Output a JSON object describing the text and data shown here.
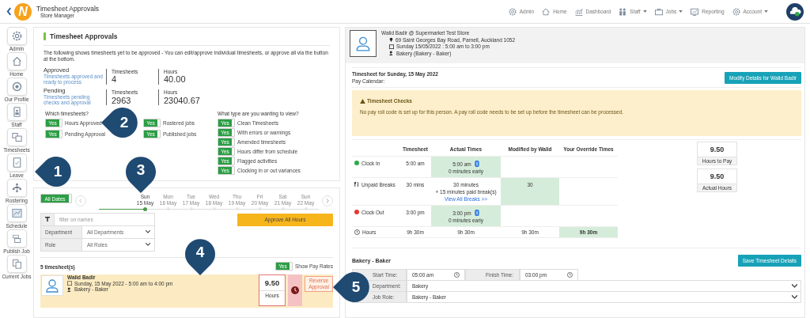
{
  "app": {
    "logo": "N",
    "title": "Timesheet Approvals",
    "subtitle": "Store Manager"
  },
  "nav": [
    {
      "label": "Admin",
      "dropdown": false
    },
    {
      "label": "Home",
      "dropdown": false
    },
    {
      "label": "Dashboard",
      "dropdown": false
    },
    {
      "label": "Staff",
      "dropdown": true
    },
    {
      "label": "Jobs",
      "dropdown": true
    },
    {
      "label": "Reporting",
      "dropdown": false
    },
    {
      "label": "Account",
      "dropdown": true
    }
  ],
  "sidebar": [
    "Admin",
    "Home",
    "Our Profile",
    "Staff",
    "Timesheets",
    "Leave",
    "Rostering",
    "Schedule",
    "Publish Job",
    "Current Jobs"
  ],
  "summary": {
    "title": "Timesheet Approvals",
    "intro": "The following shows timesheets yet to be approved - You can edit/approve individual timesheets, or approve all via the button at the bottom.",
    "stats": [
      {
        "label": "Approved",
        "note": "Timesheets approved and ready to process",
        "timesheets_label": "Timesheets",
        "timesheets": "4",
        "hours_label": "Hours",
        "hours": "40.00"
      },
      {
        "label": "Pending",
        "note": "Timesheets pending checks and approval",
        "timesheets_label": "Timesheets",
        "timesheets": "2963",
        "hours_label": "Hours",
        "hours": "23040.67"
      }
    ]
  },
  "filters": {
    "which_title": "Which timesheets?",
    "which": [
      {
        "label": "Hours Approved",
        "on": true,
        "toggle_text": "Yes"
      },
      {
        "label": "Pending Approval",
        "on": true,
        "toggle_text": "Yes"
      }
    ],
    "jobs": [
      {
        "label": "Rostered jobs",
        "on": true,
        "toggle_text": "Yes"
      },
      {
        "label": "Published jobs",
        "on": true,
        "toggle_text": "Yes"
      }
    ],
    "type_title": "What type are you wanting to view?",
    "types": [
      {
        "label": "Clean Timesheets",
        "on": true,
        "toggle_text": "Yes"
      },
      {
        "label": "With errors or warnings",
        "on": true,
        "toggle_text": "Yes"
      },
      {
        "label": "Amended timesheets",
        "on": true,
        "toggle_text": "Yes"
      },
      {
        "label": "Hours differ from schedule",
        "on": true,
        "toggle_text": "Yes"
      },
      {
        "label": "Flagged activities",
        "on": true,
        "toggle_text": "Yes"
      },
      {
        "label": "Clocking in or out variances",
        "on": true,
        "toggle_text": "Yes"
      }
    ]
  },
  "dates": {
    "all_dates": {
      "label": "All Dates",
      "on": true
    },
    "days": [
      {
        "day": "Sun",
        "date": "15 May",
        "selected": true
      },
      {
        "day": "Mon",
        "date": "16 May",
        "selected": false
      },
      {
        "day": "Tue",
        "date": "17 May",
        "selected": false
      },
      {
        "day": "Wed",
        "date": "18 May",
        "selected": false
      },
      {
        "day": "Thu",
        "date": "19 May",
        "selected": false
      },
      {
        "day": "Fri",
        "date": "20 May",
        "selected": false
      },
      {
        "day": "Sat",
        "date": "21 May",
        "selected": false
      },
      {
        "day": "Sun",
        "date": "22 May",
        "selected": false
      }
    ]
  },
  "search": {
    "placeholder": "filter on names"
  },
  "selects": [
    {
      "label": "Department",
      "value": "All Departments"
    },
    {
      "label": "Role",
      "value": "All Roles"
    }
  ],
  "approve_button": "Approve All Hours",
  "count": "5 timesheet(s)",
  "pay_rates": {
    "label": "Show Pay Rates",
    "on": true,
    "toggle_text": "Yes"
  },
  "timesheet_row": {
    "name": "Walid Badir",
    "when": "Sunday, 15 May 2022 - 5:00 am to 4:00 pm",
    "role": "Bakery - Baker",
    "hours": "9.50",
    "hours_label": "Hours",
    "action": "Reverse Approval"
  },
  "profile": {
    "heading": "Walid Badir @ Supermarket Test Store",
    "address": "69 Saint Georges Bay Road, Parnell, Auckland 1052",
    "shift": "Sunday 15/05/2022 : 5:00 am to 3:00 pm",
    "department": "Bakery (Bakery - Baker)"
  },
  "timesheet": {
    "title": "Timesheet for Sunday, 15 May 2022",
    "pay_calendar": "Pay Calendar:",
    "modify_button": "Modify Details for Walid Badir"
  },
  "checks": {
    "title": "Timesheet Checks",
    "message": "No pay roll code is set up for this person. A pay roll code needs to be set up before the timesheet can be processed."
  },
  "table": {
    "columns": [
      "Timesheet",
      "Actual Times",
      "Modified by Walid",
      "Your Override Times"
    ],
    "rows": [
      {
        "label": "Clock In",
        "kind": "clock_in",
        "cells": [
          {
            "lines": [
              "5:00 am"
            ],
            "highlighted": false
          },
          {
            "lines": [
              "5:00 am",
              "0 minutes early"
            ],
            "bluetooth": true,
            "highlighted": true
          },
          {
            "highlighted": false
          },
          {
            "highlighted": false
          }
        ]
      },
      {
        "label": "Unpaid Breaks",
        "kind": "breaks",
        "cells": [
          {
            "lines": [
              "30 mins"
            ],
            "highlighted": false
          },
          {
            "lines": [
              "30 minutes",
              "+ 15 minutes paid break(s)"
            ],
            "link": "View All Breaks >>",
            "highlighted": false
          },
          {
            "lines": [
              "30"
            ],
            "highlighted": true
          },
          {
            "highlighted": false
          }
        ]
      },
      {
        "label": "Clock Out",
        "kind": "clock_out",
        "cells": [
          {
            "lines": [
              "3:00 pm"
            ],
            "highlighted": false
          },
          {
            "lines": [
              "3:00 pm",
              "0 minutes early"
            ],
            "bluetooth": true,
            "highlighted": true
          },
          {
            "highlighted": false
          },
          {
            "highlighted": false
          }
        ]
      },
      {
        "label": "Hours",
        "kind": "hours",
        "cells": [
          {
            "lines": [
              "9h 30m"
            ],
            "highlighted": false
          },
          {
            "lines": [
              "9h 30m"
            ],
            "highlighted": false
          },
          {
            "lines": [
              "9h 30m"
            ],
            "highlighted": false
          },
          {
            "lines": [
              "9h 30m"
            ],
            "highlighted": true,
            "bold": true
          }
        ]
      }
    ]
  },
  "totals": [
    {
      "value": "9.50",
      "label": "Hours to Pay"
    },
    {
      "value": "9.50",
      "label": "Actual Hours"
    }
  ],
  "form": {
    "title": "Bakery - Baker",
    "save_button": "Save Timesheet Details",
    "start": {
      "label": "Start Time:",
      "value": "05:00 am"
    },
    "finish": {
      "label": "Finish Time:",
      "value": "03:00 pm"
    },
    "selects": [
      {
        "label": "Department:",
        "value": "Bakery"
      },
      {
        "label": "Job Role:",
        "value": "Bakery - Baker"
      }
    ]
  },
  "callouts": [
    {
      "number": "1",
      "kind": "pointer_left"
    },
    {
      "number": "2",
      "kind": "pointer_left"
    },
    {
      "number": "3",
      "kind": "pointer_down"
    },
    {
      "number": "4",
      "kind": "pointer_down"
    },
    {
      "number": "5",
      "kind": "pointer_left"
    }
  ]
}
